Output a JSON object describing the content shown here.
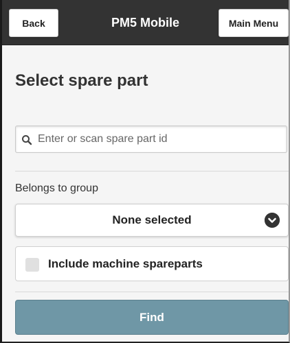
{
  "header": {
    "title": "PM5 Mobile",
    "back_label": "Back",
    "main_menu_label": "Main Menu"
  },
  "page": {
    "title": "Select spare part"
  },
  "search": {
    "placeholder": "Enter or scan spare part id",
    "value": "",
    "icon": "search-icon"
  },
  "group": {
    "label": "Belongs to group",
    "selected": "None selected",
    "icon": "chevron-down-circle-icon"
  },
  "include_machine": {
    "label": "Include machine spareparts",
    "checked": false
  },
  "find": {
    "label": "Find"
  },
  "colors": {
    "header_bg": "#333333",
    "find_button_bg": "#6f97a6",
    "page_bg": "#f5f5f5"
  }
}
